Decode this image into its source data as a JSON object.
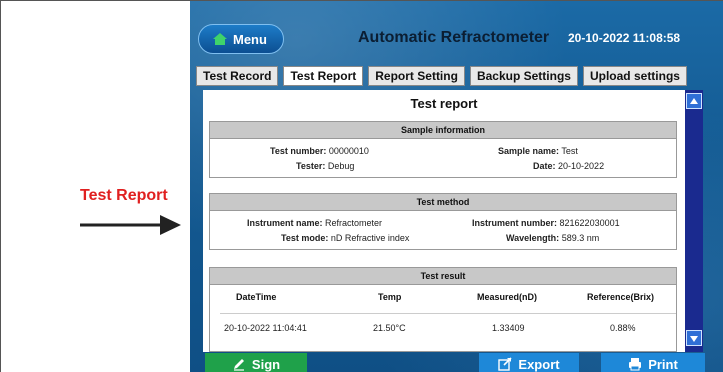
{
  "callout": {
    "label": "Test Report"
  },
  "header": {
    "menu_label": "Menu",
    "app_title": "Automatic Refractometer",
    "datetime": "20-10-2022 11:08:58"
  },
  "tabs": [
    {
      "label": "Test Record"
    },
    {
      "label": "Test Report",
      "active": true
    },
    {
      "label": "Report Setting"
    },
    {
      "label": "Backup Settings"
    },
    {
      "label": "Upload settings"
    }
  ],
  "report": {
    "title": "Test report",
    "sample_info": {
      "heading": "Sample information",
      "test_number_label": "Test number:",
      "test_number": "00000010",
      "sample_name_label": "Sample name:",
      "sample_name": "Test",
      "tester_label": "Tester:",
      "tester": "Debug",
      "date_label": "Date:",
      "date": "20-10-2022"
    },
    "test_method": {
      "heading": "Test method",
      "instrument_name_label": "Instrument name:",
      "instrument_name": "Refractometer",
      "instrument_number_label": "Instrument number:",
      "instrument_number": "821622030001",
      "test_mode_label": "Test mode:",
      "test_mode": "nD Refractive index",
      "wavelength_label": "Wavelength:",
      "wavelength": "589.3 nm"
    },
    "test_result": {
      "heading": "Test result",
      "columns": [
        "DateTime",
        "Temp",
        "Measured(nD)",
        "Reference(Brix)"
      ],
      "rows": [
        [
          "20-10-2022 11:04:41",
          "21.50°C",
          "1.33409",
          "0.88%"
        ]
      ]
    }
  },
  "buttons": {
    "sign": "Sign",
    "export": "Export",
    "print": "Print"
  },
  "colors": {
    "accent_red": "#e02020",
    "screen_blue": "#145b93",
    "sign_green": "#1fa14a",
    "action_blue": "#1e88d8"
  }
}
